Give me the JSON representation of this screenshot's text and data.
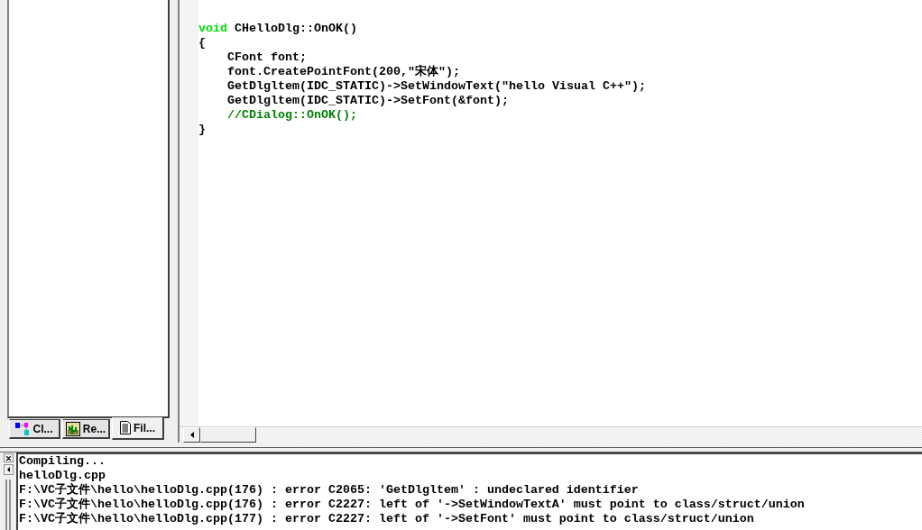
{
  "workspace": {
    "tabs": [
      {
        "label": "Cl...",
        "kind": "class",
        "selected": false
      },
      {
        "label": "Re...",
        "kind": "resource",
        "selected": false
      },
      {
        "label": "Fil...",
        "kind": "file",
        "selected": true
      }
    ]
  },
  "editor": {
    "lines": [
      {
        "kind": "blank"
      },
      {
        "kind": "code",
        "segments": [
          {
            "kind": "keyword",
            "text": "void"
          },
          {
            "kind": "plain",
            "text": "CHelloDlg::OnOK()"
          }
        ]
      },
      {
        "kind": "code",
        "segments": [
          {
            "kind": "plain",
            "text": "{"
          }
        ],
        "children": [
          {
            "kind": "code",
            "segments": [
              {
                "kind": "plain",
                "text": "CFont font;"
              }
            ]
          },
          {
            "kind": "code",
            "segments": [
              {
                "kind": "plain",
                "text": "font.CreatePointFont(200,\"宋体\");"
              }
            ]
          },
          {
            "kind": "code",
            "segments": [
              {
                "kind": "plain",
                "text": "GetDlgltem(IDC_STATIC)->SetWindowText(\"hello Visual C++\");"
              }
            ]
          },
          {
            "kind": "code",
            "segments": [
              {
                "kind": "plain",
                "text": "GetDlgltem(IDC_STATIC)->SetFont(&font);"
              }
            ]
          },
          {
            "kind": "code",
            "segments": [
              {
                "kind": "comment",
                "text": "//CDialog::OnOK();"
              }
            ]
          }
        ]
      },
      {
        "kind": "code",
        "segments": [
          {
            "kind": "plain",
            "text": "}"
          }
        ]
      }
    ]
  },
  "output": {
    "lines": [
      "Compiling...",
      "helloDlg.cpp",
      "F:\\VC子文件\\hello\\helloDlg.cpp(176) : error C2065: 'GetDlgltem' : undeclared identifier",
      "F:\\VC子文件\\hello\\helloDlg.cpp(176) : error C2227: left of '->SetWindowTextA' must point to class/struct/union",
      "F:\\VC子文件\\hello\\helloDlg.cpp(177) : error C2227: left of '->SetFont' must point to class/struct/union"
    ]
  }
}
